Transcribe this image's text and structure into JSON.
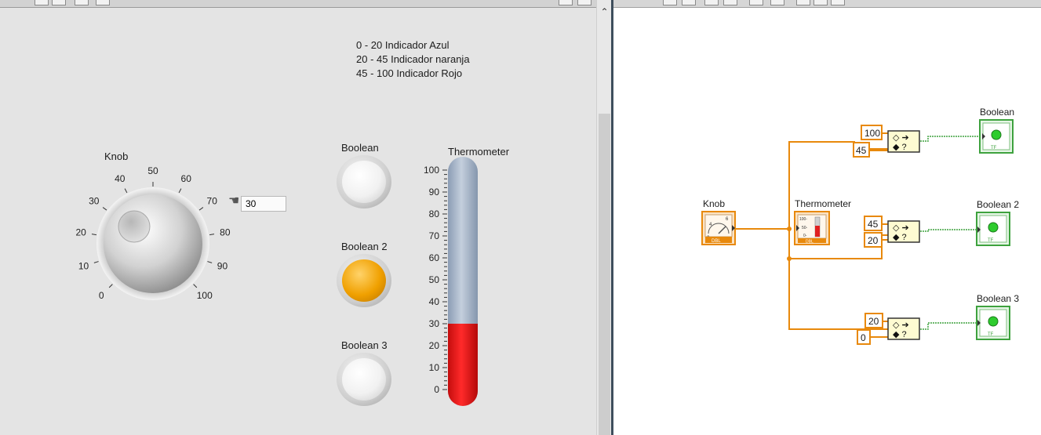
{
  "front_panel": {
    "notes": [
      "0 - 20 Indicador Azul",
      "20 - 45 Indicador naranja",
      "45 - 100 Indicador Rojo"
    ],
    "knob": {
      "label": "Knob",
      "value": 30,
      "value_text": "30",
      "ticks": [
        "0",
        "10",
        "20",
        "30",
        "40",
        "50",
        "60",
        "70",
        "80",
        "90",
        "100"
      ]
    },
    "booleans": [
      {
        "label": "Boolean",
        "state": "off",
        "color": "#ffffff"
      },
      {
        "label": "Boolean 2",
        "state": "on",
        "color": "#f0a000"
      },
      {
        "label": "Boolean 3",
        "state": "off",
        "color": "#ffffff"
      }
    ],
    "thermometer": {
      "label": "Thermometer",
      "value": 30,
      "range": [
        0,
        100
      ],
      "ticks": [
        "100",
        "90",
        "80",
        "70",
        "60",
        "50",
        "40",
        "30",
        "20",
        "10",
        "0"
      ],
      "fill_color": "#e81c1c",
      "empty_color": "#a9b8cc"
    }
  },
  "block_diagram": {
    "knob_label": "Knob",
    "thermo_label": "Thermometer",
    "knob_icon_text": {
      "dbl": "DBL",
      "ticks": [
        "2",
        "4",
        "6"
      ]
    },
    "thermo_icon_text": {
      "dbl": "DBL",
      "ticks": [
        "100-",
        "50-",
        "0-"
      ]
    },
    "range_checks": [
      {
        "upper": "100",
        "lower": "45",
        "indicator": "Boolean"
      },
      {
        "upper": "45",
        "lower": "20",
        "indicator": "Boolean 2"
      },
      {
        "upper": "20",
        "lower": "0",
        "indicator": "Boolean 3"
      }
    ],
    "indicator_tag": "TF",
    "wire_color": "#e8890c",
    "bool_wire_color": "#3ea23e"
  }
}
